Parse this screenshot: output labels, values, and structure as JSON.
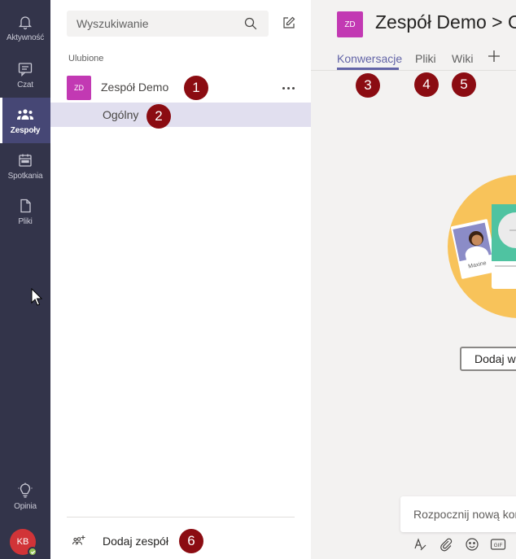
{
  "rail": {
    "items": [
      {
        "label": "Aktywność",
        "icon": "bell-icon"
      },
      {
        "label": "Czat",
        "icon": "chat-icon"
      },
      {
        "label": "Zespoły",
        "icon": "teams-icon"
      },
      {
        "label": "Spotkania",
        "icon": "calendar-icon"
      },
      {
        "label": "Pliki",
        "icon": "file-icon"
      }
    ],
    "feedback_label": "Opinia",
    "avatar_initials": "KB"
  },
  "panel": {
    "search_placeholder": "Wyszukiwanie",
    "section_label": "Ulubione",
    "team": {
      "initials": "ZD",
      "name": "Zespół Demo"
    },
    "channel": {
      "name": "Ogólny"
    },
    "add_team_label": "Dodaj zespół"
  },
  "markers": [
    "1",
    "2",
    "3",
    "4",
    "5",
    "6"
  ],
  "main": {
    "avatar_initials": "ZD",
    "title": "Zespół Demo > Ogólny",
    "tabs": [
      "Konwersacje",
      "Pliki",
      "Wiki"
    ],
    "illustration_name": "Maxine",
    "add_button_label": "Dodaj więcej osób",
    "compose_placeholder": "Rozpocznij nową konwersację",
    "gif_label": "GIF"
  },
  "colors": {
    "rail": "#33344a",
    "accent": "#6264a7",
    "team_avatar": "#c239b3",
    "marker": "#8b0c12"
  }
}
